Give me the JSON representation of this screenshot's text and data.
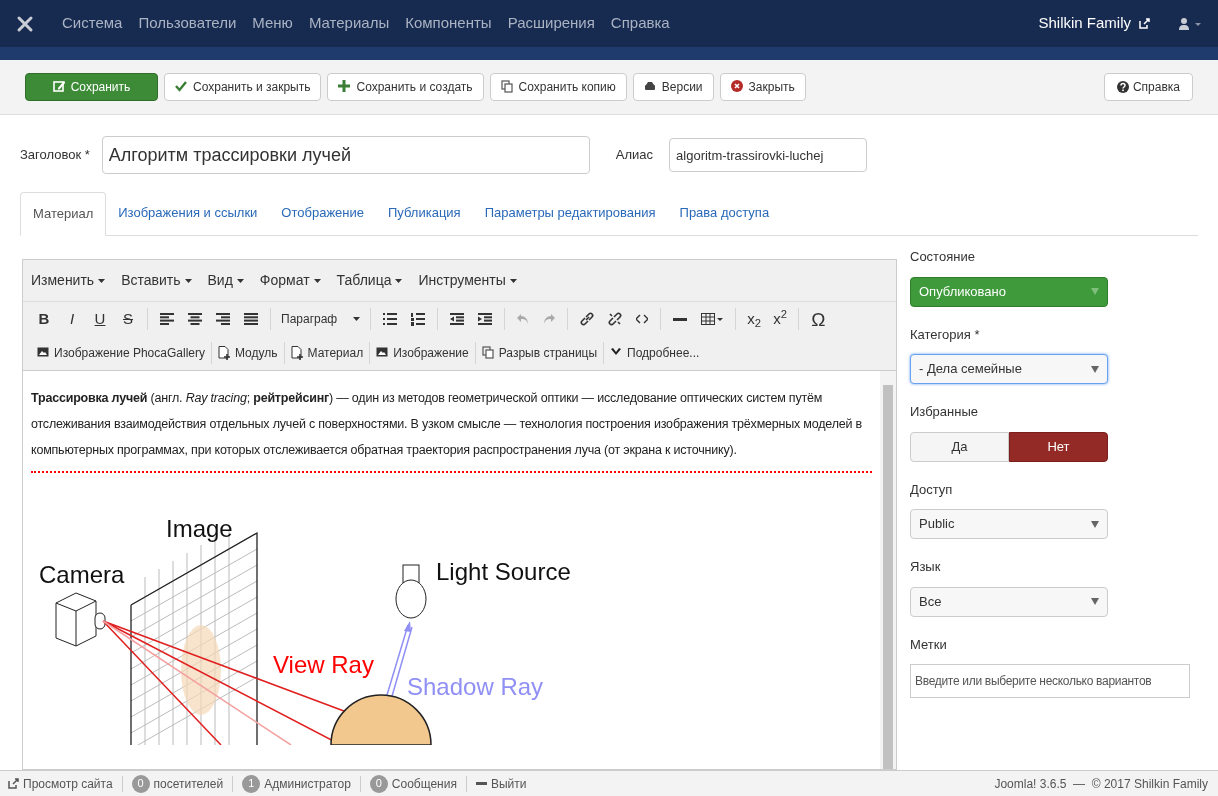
{
  "nav": {
    "menu": [
      "Система",
      "Пользователи",
      "Меню",
      "Материалы",
      "Компоненты",
      "Расширения",
      "Справка"
    ],
    "user": "Shilkin Family"
  },
  "toolbar": {
    "buttons": [
      {
        "label": "Сохранить",
        "kind": "primary"
      },
      {
        "label": "Сохранить и закрыть",
        "kind": "default"
      },
      {
        "label": "Сохранить и создать",
        "kind": "default"
      },
      {
        "label": "Сохранить копию",
        "kind": "default"
      },
      {
        "label": "Версии",
        "kind": "default"
      },
      {
        "label": "Закрыть",
        "kind": "default"
      }
    ],
    "help": "Справка"
  },
  "title_field": {
    "label": "Заголовок *",
    "value": "Алгоритм трассировки лучей"
  },
  "alias_field": {
    "label": "Алиас",
    "value": "algoritm-trassirovki-luchej"
  },
  "tabs": [
    {
      "label": "Материал",
      "selected": true
    },
    {
      "label": "Изображения и ссылки",
      "selected": false
    },
    {
      "label": "Отображение",
      "selected": false
    },
    {
      "label": "Публикация",
      "selected": false
    },
    {
      "label": "Параметры редактирования",
      "selected": false
    },
    {
      "label": "Права доступа",
      "selected": false
    }
  ],
  "editor": {
    "menus": [
      "Изменить",
      "Вставить",
      "Вид",
      "Формат",
      "Таблица",
      "Инструменты"
    ],
    "letter_buttons": [
      "B",
      "I",
      "U",
      "S"
    ],
    "format_select": "Параграф",
    "script_buttons": [
      "x$_{2}$",
      "x$^{2}$"
    ],
    "special_char": "Ω",
    "insert_buttons": [
      "Изображение PhocaGallery",
      "Модуль",
      "Материал",
      "Изображение",
      "Разрыв страницы",
      "Подробнее..."
    ],
    "paragraph": "**Трассировка лучей** (англ. *Ray tracing*; **рейтрейсинг**) — один из методов геометрической оптики — исследование оптических систем путём отслеживания взаимодействия отдельных лучей с поверхностями. В узком смысле — технология построения изображения трёхмерных моделей в компьютерных программах, при которых отслеживается обратная траектория распространения луча (от экрана к источнику).",
    "figure_labels": {
      "image": "Image",
      "camera": "Camera",
      "light": "Light Source",
      "view_ray": "View Ray",
      "shadow_ray": "Shadow Ray"
    }
  },
  "sidebar": [
    {
      "kind": "status",
      "label": "Состояние",
      "value": "Опубликовано"
    },
    {
      "kind": "select",
      "label": "Категория *",
      "value": "- Дела семейные",
      "focused": true
    },
    {
      "kind": "toggle",
      "label": "Избранные",
      "options": [
        {
          "label": "Да",
          "selected": false
        },
        {
          "label": "Нет",
          "selected": true
        }
      ]
    },
    {
      "kind": "select",
      "label": "Доступ",
      "value": "Public",
      "focused": false
    },
    {
      "kind": "select",
      "label": "Язык",
      "value": "Все",
      "focused": false
    },
    {
      "kind": "tags",
      "label": "Метки",
      "placeholder": "Введите или выберите несколько вариантов"
    }
  ],
  "status_bar": {
    "items": [
      {
        "kind": "link",
        "label": "Просмотр сайта"
      },
      {
        "kind": "count",
        "badge": "0",
        "label": "посетителей"
      },
      {
        "kind": "count",
        "badge": "1",
        "label": "Администратор"
      },
      {
        "kind": "count",
        "badge": "0",
        "label": "Сообщения"
      },
      {
        "kind": "logout",
        "label": "Выйти"
      }
    ],
    "copyright": "Joomla! 3.6.5  —  © 2017 Shilkin Family"
  }
}
